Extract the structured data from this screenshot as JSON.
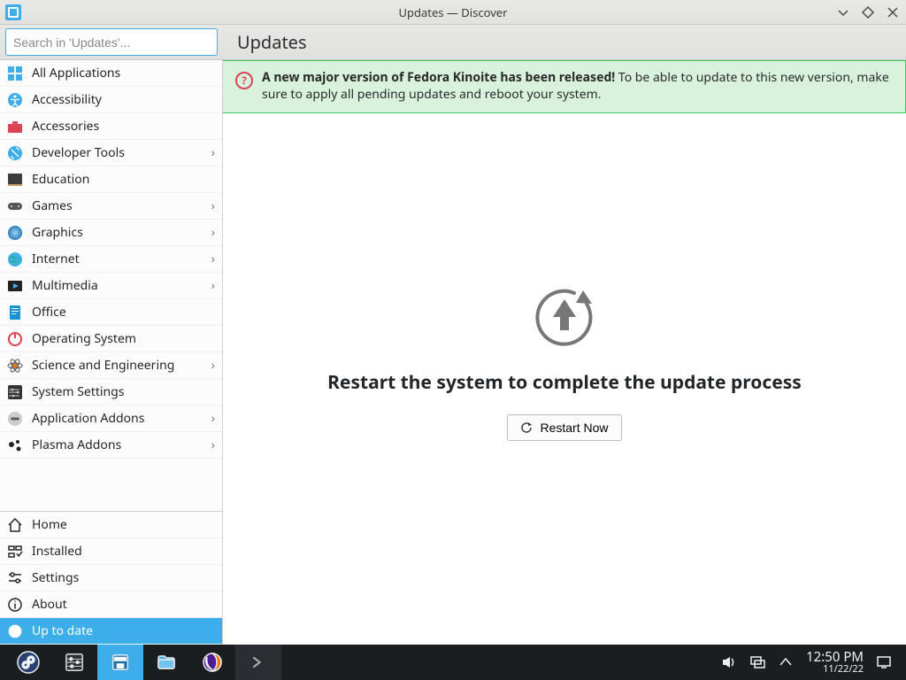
{
  "window": {
    "title": "Updates — Discover"
  },
  "header": {
    "search_placeholder": "Search in 'Updates'...",
    "heading": "Updates"
  },
  "sidebar": {
    "categories": [
      {
        "label": "All Applications",
        "arrow": false
      },
      {
        "label": "Accessibility",
        "arrow": false
      },
      {
        "label": "Accessories",
        "arrow": false
      },
      {
        "label": "Developer Tools",
        "arrow": true
      },
      {
        "label": "Education",
        "arrow": false
      },
      {
        "label": "Games",
        "arrow": true
      },
      {
        "label": "Graphics",
        "arrow": true
      },
      {
        "label": "Internet",
        "arrow": true
      },
      {
        "label": "Multimedia",
        "arrow": true
      },
      {
        "label": "Office",
        "arrow": false
      },
      {
        "label": "Operating System",
        "arrow": false
      },
      {
        "label": "Science and Engineering",
        "arrow": true
      },
      {
        "label": "System Settings",
        "arrow": false
      },
      {
        "label": "Application Addons",
        "arrow": true
      },
      {
        "label": "Plasma Addons",
        "arrow": true
      }
    ],
    "bottom": [
      {
        "label": "Home"
      },
      {
        "label": "Installed"
      },
      {
        "label": "Settings"
      },
      {
        "label": "About"
      },
      {
        "label": "Up to date",
        "selected": true
      }
    ]
  },
  "banner": {
    "bold": "A new major version of Fedora Kinoite has been released!",
    "text": " To be able to update to this new version, make sure to apply all pending updates and reboot your system."
  },
  "main": {
    "message": "Restart the system to complete the update process",
    "button_label": "Restart Now"
  },
  "taskbar": {
    "time": "12:50 PM",
    "date": "11/22/22"
  }
}
